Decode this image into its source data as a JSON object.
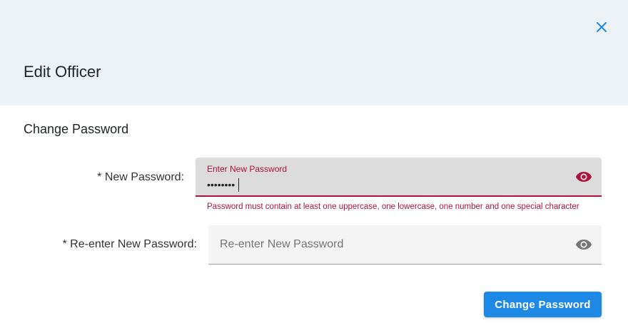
{
  "dialog": {
    "title": "Edit Officer",
    "close_icon": "close-icon"
  },
  "section": {
    "title": "Change Password"
  },
  "new_password": {
    "label": "* New Password:",
    "floating_label": "Enter New Password",
    "value": "••••••••",
    "error": "Password must contain at least one uppercase, one lowercase, one number and one special character",
    "toggle_icon": "eye-icon"
  },
  "reenter_password": {
    "label": "* Re-enter New Password:",
    "placeholder": "Re-enter New Password",
    "value": "",
    "toggle_icon": "eye-icon"
  },
  "submit": {
    "label": "Change Password"
  },
  "colors": {
    "accent": "#1e88e5",
    "error": "#b0123f",
    "header_bg": "#edf2f7"
  }
}
